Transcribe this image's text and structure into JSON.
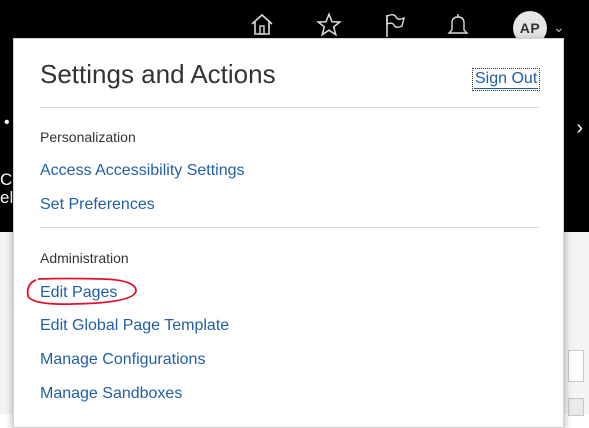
{
  "header": {
    "avatar_initials": "AP",
    "icons": [
      "home-icon",
      "star-icon",
      "flag-icon",
      "bell-icon",
      "chevron-down-icon"
    ]
  },
  "background": {
    "fragment_1": "Ca",
    "fragment_2": "el"
  },
  "popup": {
    "title": "Settings and Actions",
    "sign_out_label": "Sign Out",
    "sections": [
      {
        "heading": "Personalization",
        "items": [
          {
            "label": "Access Accessibility Settings"
          },
          {
            "label": "Set Preferences"
          }
        ]
      },
      {
        "heading": "Administration",
        "items": [
          {
            "label": "Edit Pages"
          },
          {
            "label": "Edit Global Page Template"
          },
          {
            "label": "Manage Configurations"
          },
          {
            "label": "Manage Sandboxes"
          }
        ]
      }
    ]
  },
  "colors": {
    "link": "#1f5fa6",
    "annotation": "#e3102a",
    "header_bg": "#000000"
  }
}
